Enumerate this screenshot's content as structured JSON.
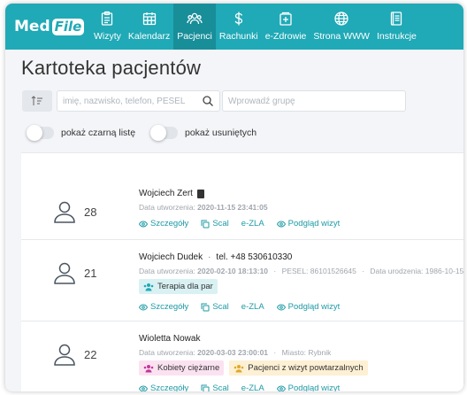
{
  "logo": {
    "part1": "Med",
    "part2": "File"
  },
  "nav": [
    {
      "label": "Wizyty",
      "icon": "clipboard-icon"
    },
    {
      "label": "Kalendarz",
      "icon": "calendar-icon"
    },
    {
      "label": "Pacjenci",
      "icon": "users-icon",
      "active": true
    },
    {
      "label": "Rachunki",
      "icon": "dollar-icon"
    },
    {
      "label": "e-Zdrowie",
      "icon": "medical-cross-icon"
    },
    {
      "label": "Strona WWW",
      "icon": "globe-icon"
    },
    {
      "label": "Instrukcje",
      "icon": "book-icon"
    }
  ],
  "page": {
    "title": "Kartoteka pacjentów"
  },
  "search": {
    "placeholder": "imię, nazwisko, telefon, PESEL"
  },
  "group_filter": {
    "placeholder": "Wprowadź grupę"
  },
  "toggles": {
    "blacklist": "pokaż czarną listę",
    "deleted": "pokaż usuniętych"
  },
  "actions": {
    "details": "Szczegóły",
    "merge": "Scal",
    "ezla": "e-ZLA",
    "visits": "Podgląd wizyt"
  },
  "patients": [
    {
      "id": "28",
      "name": "Wojciech Zert",
      "phone": "",
      "created_label": "Data utworzenia:",
      "created": "2020-11-15 23:41:05",
      "extra": []
    },
    {
      "id": "21",
      "name": "Wojciech Dudek",
      "phone": "tel. +48 530610330",
      "created_label": "Data utworzenia:",
      "created": "2020-02-10 18:13:10",
      "extra": [
        {
          "label": "PESEL:",
          "value": "86101526645"
        },
        {
          "label": "Data urodzenia:",
          "value": "1986-10-15"
        }
      ],
      "tags": [
        {
          "label": "Terapia dla par",
          "color": "#d9f1f3"
        }
      ]
    },
    {
      "id": "22",
      "name": "Wioletta Nowak",
      "phone": "",
      "created_label": "Data utworzenia:",
      "created": "2020-03-03 23:00:01",
      "extra": [
        {
          "label": "Miasto:",
          "value": "Rybnik"
        }
      ],
      "tags": [
        {
          "label": "Kobiety ciężarne",
          "color": "#fbe2f1"
        },
        {
          "label": "Pacjenci z wizyt powtarzalnych",
          "color": "#fdf0d4"
        }
      ]
    }
  ],
  "colors": {
    "brand": "#20a9b6",
    "brand_dark": "#188e99",
    "link": "#1d9aa6"
  }
}
